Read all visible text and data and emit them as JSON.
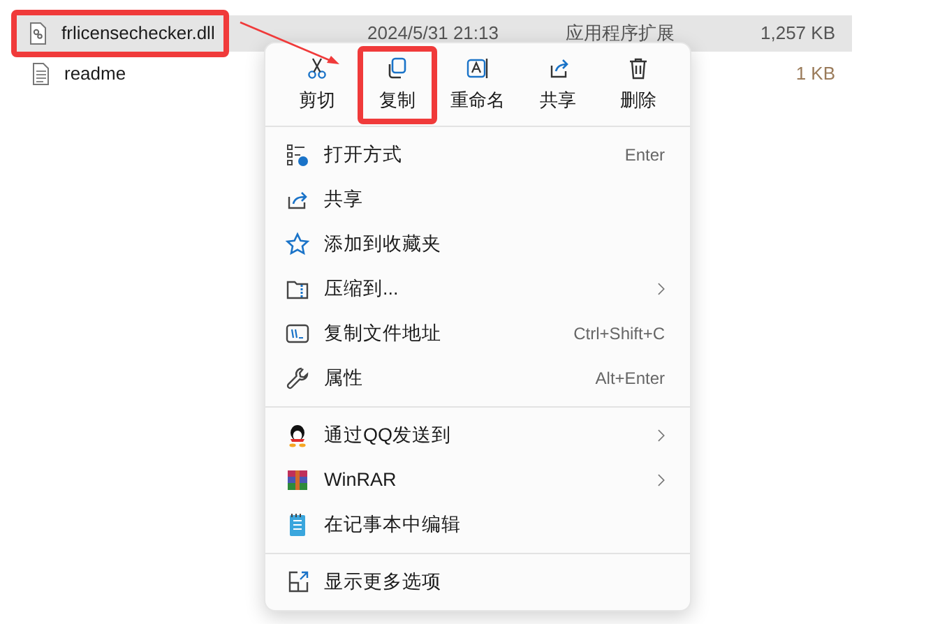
{
  "files": [
    {
      "name": "frlicensechecker.dll",
      "modified": "2024/5/31 21:13",
      "type": "应用程序扩展",
      "size": "1,257 KB",
      "selected": true,
      "annotated": true
    },
    {
      "name": "readme",
      "size": "1 KB",
      "selected": false,
      "annotated": false
    }
  ],
  "context_menu": {
    "actions": [
      {
        "label": "剪切",
        "annotated": false
      },
      {
        "label": "复制",
        "annotated": true
      },
      {
        "label": "重命名",
        "annotated": false
      },
      {
        "label": "共享",
        "annotated": false
      },
      {
        "label": "删除",
        "annotated": false
      }
    ],
    "sections": [
      [
        {
          "label": "打开方式",
          "shortcut": "Enter",
          "submenu": false
        },
        {
          "label": "共享",
          "submenu": false
        },
        {
          "label": "添加到收藏夹",
          "submenu": false
        },
        {
          "label": "压缩到...",
          "submenu": true
        },
        {
          "label": "复制文件地址",
          "shortcut": "Ctrl+Shift+C",
          "submenu": false
        },
        {
          "label": "属性",
          "shortcut": "Alt+Enter",
          "submenu": false
        }
      ],
      [
        {
          "label": "通过QQ发送到",
          "submenu": true
        },
        {
          "label": "WinRAR",
          "submenu": true
        },
        {
          "label": "在记事本中编辑",
          "submenu": false
        }
      ],
      [
        {
          "label": "显示更多选项",
          "submenu": false
        }
      ]
    ]
  }
}
